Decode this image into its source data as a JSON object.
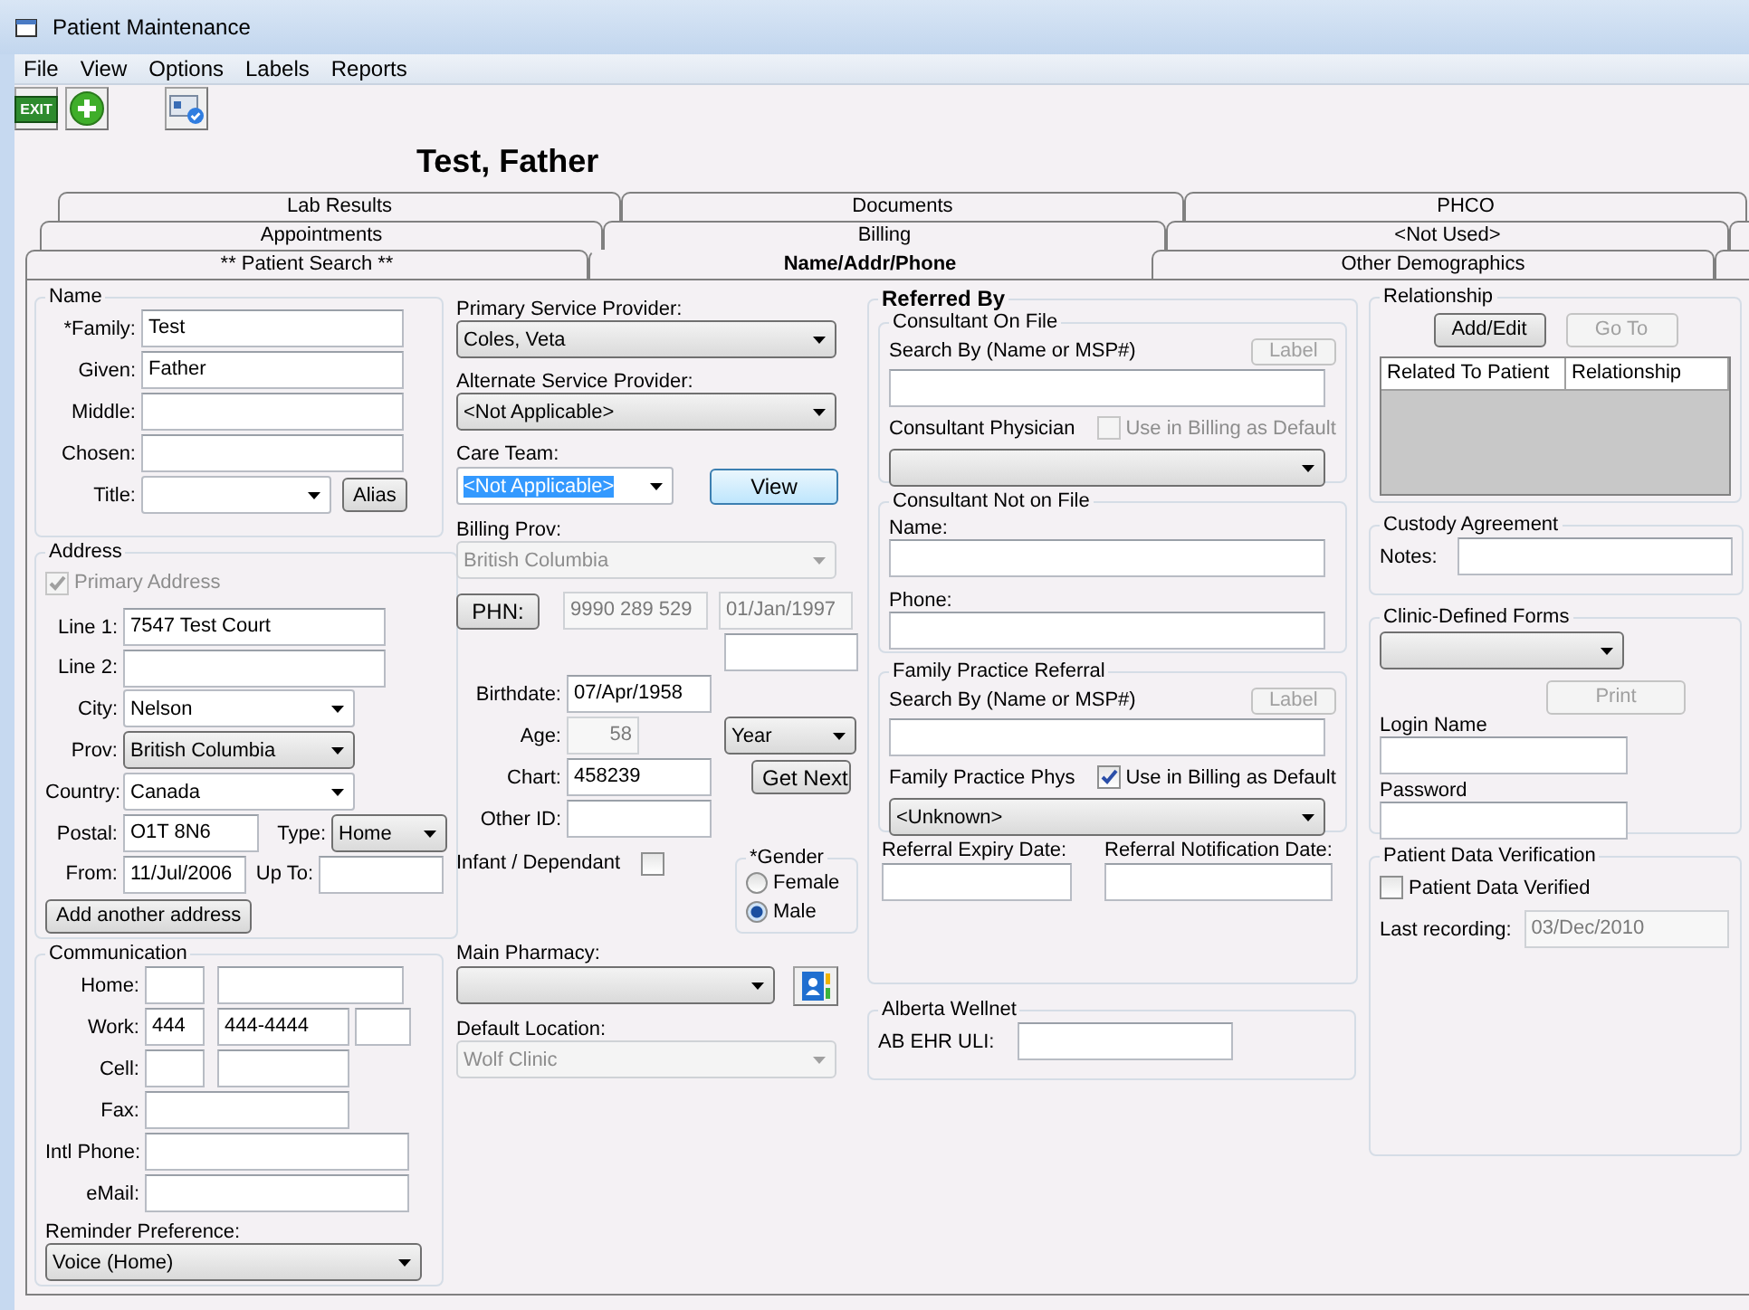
{
  "window": {
    "title": "Patient Maintenance"
  },
  "menu": [
    "File",
    "View",
    "Options",
    "Labels",
    "Reports"
  ],
  "toolbar": {
    "exit_label": "EXIT"
  },
  "patient_name": "Test, Father",
  "tab_rows": [
    [
      {
        "label": "Lab Results",
        "selected": false
      },
      {
        "label": "Documents",
        "selected": false
      },
      {
        "label": "PHCO",
        "selected": false
      }
    ],
    [
      {
        "label": "Appointments",
        "selected": false
      },
      {
        "label": "Billing",
        "selected": false
      },
      {
        "label": "<Not Used>",
        "selected": false
      }
    ],
    [
      {
        "label": "** Patient Search **",
        "selected": false
      },
      {
        "label": "Name/Addr/Phone",
        "selected": true
      },
      {
        "label": "Other Demographics",
        "selected": false
      }
    ]
  ],
  "name_group": {
    "title": "Name",
    "fields": [
      {
        "label": "*Family:",
        "value": "Test"
      },
      {
        "label": "Given:",
        "value": "Father"
      },
      {
        "label": "Middle:"
      },
      {
        "label": "Chosen:"
      }
    ],
    "title_field": {
      "label": "Title:",
      "kind": "editable"
    },
    "alias_button": "Alias"
  },
  "address": {
    "title": "Address",
    "primary": {
      "label": "Primary Address",
      "checked": true,
      "disabled": true
    },
    "line1": {
      "label": "Line 1:",
      "value": "7547 Test Court"
    },
    "line2": {
      "label": "Line 2:"
    },
    "city": {
      "label": "City:",
      "value": "Nelson",
      "kind": "editable"
    },
    "prov": {
      "label": "Prov:",
      "value": "British Columbia",
      "kind": "list"
    },
    "country": {
      "label": "Country:",
      "value": "Canada",
      "kind": "editable"
    },
    "postal": {
      "label": "Postal:",
      "value": "O1T 8N6"
    },
    "type": {
      "label": "Type:",
      "value": "Home",
      "kind": "list"
    },
    "from": {
      "label": "From:",
      "value": "11/Jul/2006"
    },
    "up_to": {
      "label": "Up To:"
    },
    "add_button": "Add another address"
  },
  "communication": {
    "title": "Communication",
    "home": {
      "label": "Home:"
    },
    "work": {
      "label": "Work:",
      "area": "444",
      "number": "444-4444"
    },
    "cell": {
      "label": "Cell:"
    },
    "fax": {
      "label": "Fax:"
    },
    "intl": {
      "label": "Intl Phone:"
    },
    "email": {
      "label": "eMail:"
    },
    "reminder": {
      "label": "Reminder Preference:",
      "value": "Voice (Home)",
      "kind": "list"
    }
  },
  "providers": {
    "primary": {
      "label": "Primary Service Provider:",
      "value": "Coles, Veta",
      "kind": "list"
    },
    "alternate": {
      "label": "Alternate Service Provider:",
      "value": "<Not Applicable>",
      "kind": "list"
    },
    "care_team": {
      "label": "Care Team:",
      "value": "<Not Applicable>",
      "kind": "editable",
      "highlighted": true
    },
    "view_button": "View",
    "billing_prov": {
      "label": "Billing Prov:",
      "value": "British Columbia",
      "kind": "list",
      "disabled": true
    }
  },
  "ids": {
    "phn_button": "PHN:",
    "phn": {
      "value": "9990 289 529",
      "disabled": true
    },
    "phn_date": {
      "value": "01/Jan/1997",
      "disabled": true
    },
    "birthdate": {
      "label": "Birthdate:",
      "value": "07/Apr/1958"
    },
    "age": {
      "label": "Age:",
      "value": "58",
      "disabled": true
    },
    "age_unit": {
      "value": "Year",
      "kind": "list"
    },
    "chart": {
      "label": "Chart:",
      "value": "458239"
    },
    "get_next_button": "Get Next",
    "other_id": {
      "label": "Other ID:"
    },
    "infant": {
      "label": "Infant / Dependant",
      "checked": false
    }
  },
  "gender": {
    "title": "*Gender",
    "options": [
      {
        "label": "Female",
        "selected": false
      },
      {
        "label": "Male",
        "selected": true
      }
    ]
  },
  "pharmacy": {
    "label": "Main Pharmacy:",
    "kind": "list"
  },
  "default_location": {
    "label": "Default Location:",
    "value": "Wolf Clinic",
    "kind": "list",
    "disabled": true
  },
  "referred_by": {
    "title": "Referred By",
    "on_file": {
      "title": "Consultant On File",
      "label_button": {
        "label": "Label",
        "disabled": true
      },
      "search_label": "Search By (Name or MSP#)",
      "physician_label": "Consultant Physician",
      "billing_default": {
        "label": "Use in Billing as Default",
        "checked": false,
        "disabled": true
      },
      "physician": {
        "kind": "list"
      }
    },
    "not_on_file": {
      "title": "Consultant Not on File",
      "name_label": "Name:",
      "phone_label": "Phone:"
    },
    "family_practice": {
      "title": "Family Practice Referral",
      "label_button": {
        "label": "Label",
        "disabled": true
      },
      "search_label": "Search By (Name or MSP#)",
      "physician_label": "Family Practice Phys",
      "billing_default": {
        "label": "Use in Billing as Default",
        "checked": true,
        "disabled": false
      },
      "physician": {
        "value": "<Unknown>",
        "kind": "list"
      }
    },
    "expiry_label": "Referral Expiry Date:",
    "notification_label": "Referral Notification Date:"
  },
  "alberta": {
    "title": "Alberta Wellnet",
    "uli_label": "AB EHR ULI:"
  },
  "relationship": {
    "title": "Relationship",
    "add_button": {
      "label": "Add/Edit",
      "disabled": false
    },
    "goto_button": {
      "label": "Go To",
      "disabled": true
    },
    "columns": [
      "Related To Patient",
      "Relationship"
    ]
  },
  "custody": {
    "title": "Custody Agreement",
    "notes_label": "Notes:"
  },
  "forms": {
    "title": "Clinic-Defined Forms",
    "form": {
      "kind": "list"
    },
    "print_button": {
      "label": "Print",
      "disabled": true
    },
    "login_label": "Login Name",
    "password_label": "Password"
  },
  "verification": {
    "title": "Patient Data Verification",
    "verified": {
      "label": "Patient Data Verified",
      "checked": false
    },
    "last_label": "Last recording:",
    "last": {
      "value": "03/Dec/2010",
      "disabled": true
    }
  }
}
